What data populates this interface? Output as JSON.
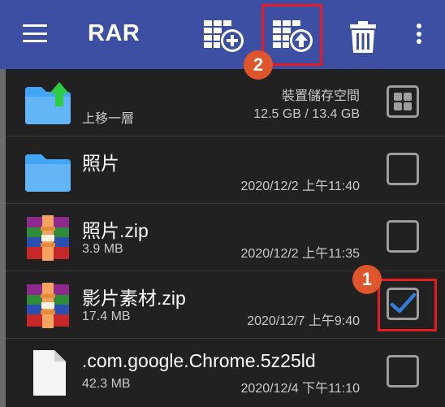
{
  "appbar": {
    "title": "RAR",
    "tools": [
      "archive-add-icon",
      "archive-extract-icon",
      "trash-icon"
    ],
    "menu_icon": "hamburger-menu-icon",
    "overflow_icon": "more-vert-icon"
  },
  "badges": {
    "first": "1",
    "second": "2"
  },
  "colors": {
    "appbar": "#3d4fa3",
    "background": "#212121",
    "highlight": "#e51c23",
    "badge": "#e0562c",
    "check": "#2f7fd8",
    "folder": "#42a5f5"
  },
  "rows": [
    {
      "name": "上移一層",
      "sub_right_top": "裝置儲存空間",
      "sub_right_bottom": "12.5 GB / 13.4 GB",
      "icon": "folder-up-icon",
      "control": "grid-view-icon"
    },
    {
      "name": "照片",
      "date": "2020/12/2 上午11:40",
      "icon": "folder-icon",
      "checked": false
    },
    {
      "name": "照片.zip",
      "size": "3.9 MB",
      "date": "2020/12/2 上午11:35",
      "icon": "winrar-archive-icon",
      "checked": false
    },
    {
      "name": "影片素材.zip",
      "size": "17.4 MB",
      "date": "2020/12/7 上午9:40",
      "icon": "winrar-archive-icon",
      "checked": true
    },
    {
      "name": ".com.google.Chrome.5z25ld",
      "size": "42.3 MB",
      "date": "2020/12/4 下午11:10",
      "icon": "file-icon",
      "checked": false
    }
  ]
}
